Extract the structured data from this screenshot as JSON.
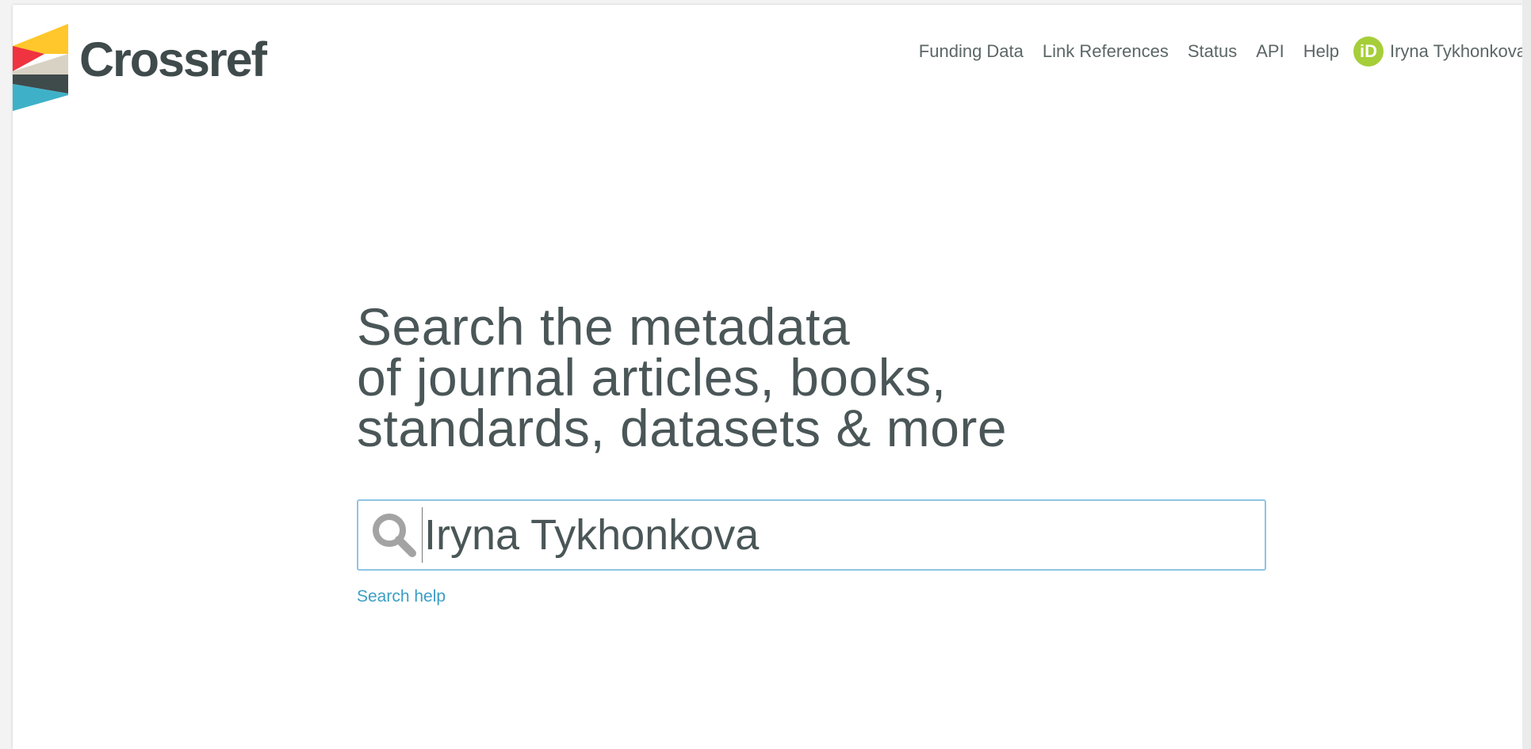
{
  "brand": {
    "name": "Crossref",
    "colors": {
      "yellow": "#ffc72c",
      "red": "#ef3340",
      "grey": "#d8d2c4",
      "dark": "#3f4a4b",
      "blue": "#3eb1c8"
    }
  },
  "nav": {
    "items": [
      {
        "label": "Funding Data"
      },
      {
        "label": "Link References"
      },
      {
        "label": "Status"
      },
      {
        "label": "API"
      },
      {
        "label": "Help"
      }
    ],
    "user": {
      "badge": "iD",
      "name": "Iryna Tykhonkova",
      "badge_color": "#a6ce39"
    }
  },
  "hero": {
    "line1": "Search the metadata",
    "line2": "of journal articles, books,",
    "line3": "standards, datasets & more"
  },
  "search": {
    "value": "Iryna Tykhonkova",
    "icon": "search-icon",
    "help_label": "Search help"
  }
}
